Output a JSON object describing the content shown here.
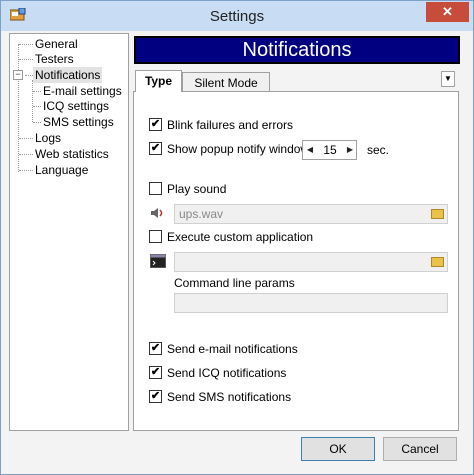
{
  "window": {
    "title": "Settings",
    "close_glyph": "✕"
  },
  "tree": {
    "items": [
      {
        "label": "General"
      },
      {
        "label": "Testers"
      },
      {
        "label": "Notifications"
      },
      {
        "label": "E-mail settings"
      },
      {
        "label": "ICQ settings"
      },
      {
        "label": "SMS settings"
      },
      {
        "label": "Logs"
      },
      {
        "label": "Web statistics"
      },
      {
        "label": "Language"
      }
    ],
    "expander_glyph": "−"
  },
  "header": {
    "title": "Notifications"
  },
  "tabs": [
    {
      "label": "Type"
    },
    {
      "label": "Silent Mode"
    }
  ],
  "tab_dropdown_glyph": "▼",
  "options": {
    "blink_failures": {
      "label": "Blink failures and errors",
      "checked": true
    },
    "show_popup": {
      "label": "Show popup notify window",
      "checked": true
    },
    "popup_seconds": "15",
    "popup_unit": "sec.",
    "play_sound": {
      "label": "Play sound",
      "checked": false
    },
    "sound_file": "ups.wav",
    "execute_custom": {
      "label": "Execute custom application",
      "checked": false
    },
    "command_line_label": "Command line params",
    "send_email": {
      "label": "Send e-mail notifications",
      "checked": true
    },
    "send_icq": {
      "label": "Send ICQ notifications",
      "checked": true
    },
    "send_sms": {
      "label": "Send SMS notifications",
      "checked": true
    }
  },
  "check_glyph": "✔",
  "stepper_glyphs": {
    "prev": "◀",
    "next": "▶"
  },
  "buttons": {
    "ok": "OK",
    "cancel": "Cancel"
  }
}
